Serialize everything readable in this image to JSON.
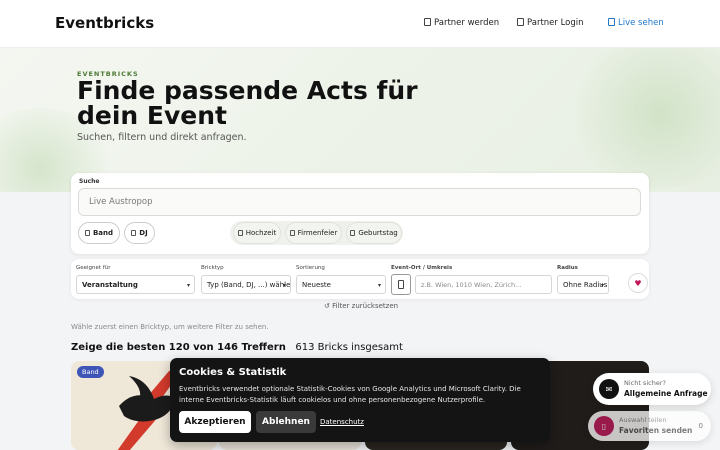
{
  "header": {
    "logo": "Eventbricks",
    "nav": [
      {
        "label": "Partner werden",
        "icon": "partner-icon"
      },
      {
        "label": "Partner Login",
        "icon": "login-icon"
      },
      {
        "label": "Live sehen",
        "icon": "live-icon"
      }
    ]
  },
  "hero": {
    "eyebrow": "EVENTBRICKS",
    "title": "Finde passende Acts für dein Event",
    "subtitle": "Suchen, filtern und direkt anfragen."
  },
  "search": {
    "label": "Suche",
    "placeholder": "Live Austropop",
    "chips": [
      "Band",
      "DJ",
      "Hochzeit",
      "Firmenfeier",
      "Geburtstag"
    ]
  },
  "filters": {
    "suitable_label": "Geeignet für",
    "suitable_value": "Veranstaltung",
    "type_label": "Bricktyp",
    "type_value": "Typ (Band, DJ, ...) wählen",
    "sort_label": "Sortierung",
    "sort_value": "Neueste",
    "location_label": "Event-Ort / Umkreis",
    "location_placeholder": "z.B. Wien, 1010 Wien, Zürich...",
    "radius_label": "Radius",
    "radius_value": "Ohne Radius",
    "reset_label": "↺  Filter zurücksetzen"
  },
  "results": {
    "hint": "Wähle zuerst einen Bricktyp, um weitere Filter zu sehen.",
    "shown": "Zeige die besten 120 von 146 Treffern",
    "total": "613 Bricks insgesamt",
    "first_badge": "Band"
  },
  "cookie": {
    "title": "Cookies & Statistik",
    "text": "Eventbricks verwendet optionale Statistik-Cookies von Google Analytics und Microsoft Clarity. Die interne Eventbricks-Statistik läuft cookielos und ohne personenbezogene Nutzerprofile.",
    "accept": "Akzeptieren",
    "decline": "Ablehnen",
    "privacy": "Datenschutz"
  },
  "floating": {
    "inquiry_small": "Nicht sicher?",
    "inquiry_big": "Allgemeine Anfrage",
    "fav_small": "Auswahl teilen",
    "fav_big": "Favoriten senden",
    "fav_count": "0"
  },
  "colors": {
    "accent": "#1f78c8",
    "badge": "#3e55b7",
    "favorite": "#c2185b",
    "eyebrow": "#4d7a35"
  }
}
